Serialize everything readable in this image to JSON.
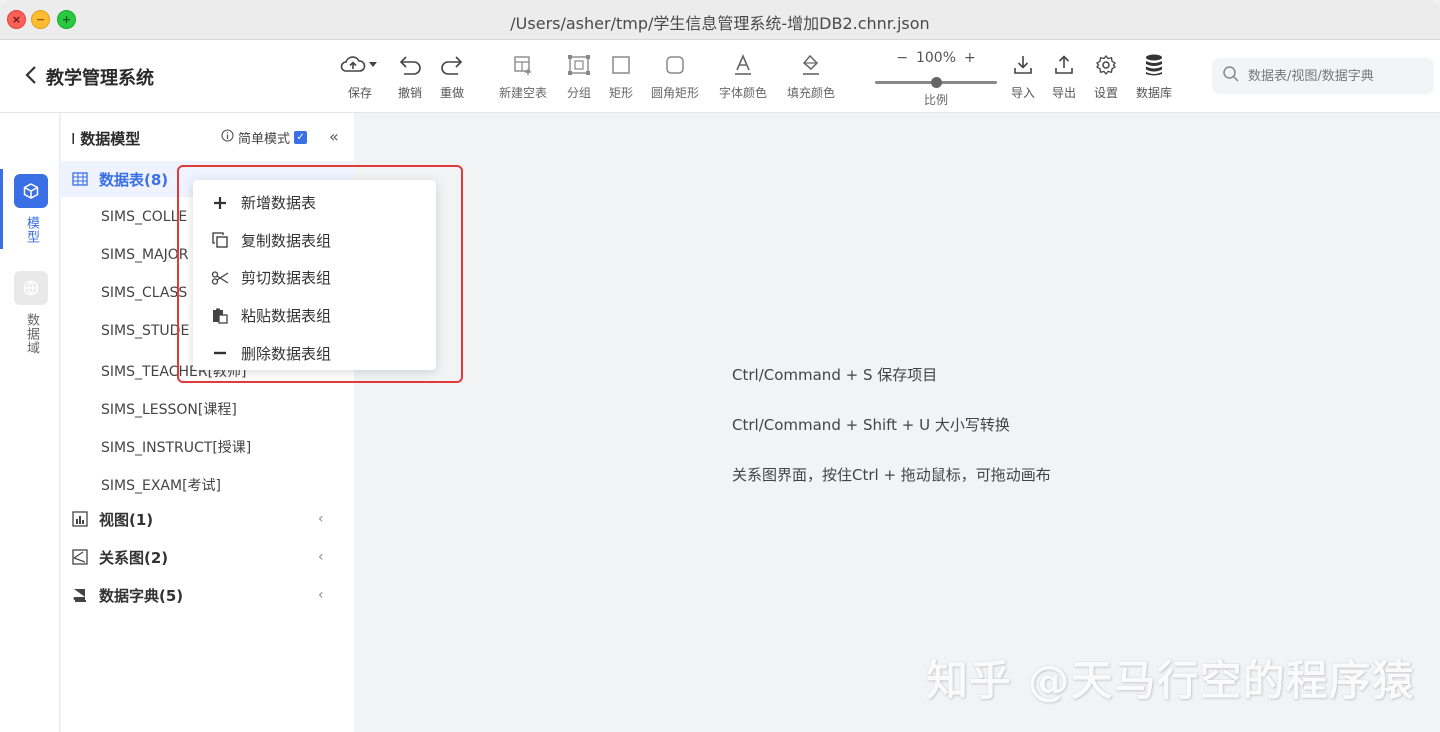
{
  "window": {
    "title": "/Users/asher/tmp/学生信息管理系统-增加DB2.chnr.json",
    "controls": {
      "close": "×",
      "minimize": "−",
      "maximize": "+"
    }
  },
  "header": {
    "app_title": "教学管理系统",
    "back_icon": "chevron-left-icon",
    "tools": [
      {
        "label": "保存",
        "icon": "cloud-upload-icon"
      },
      {
        "label": "撤销",
        "icon": "undo-icon"
      },
      {
        "label": "重做",
        "icon": "redo-icon"
      },
      {
        "label": "新建空表",
        "icon": "new-table-icon"
      },
      {
        "label": "分组",
        "icon": "group-icon"
      },
      {
        "label": "矩形",
        "icon": "rectangle-icon"
      },
      {
        "label": "圆角矩形",
        "icon": "rounded-rectangle-icon"
      },
      {
        "label": "字体颜色",
        "icon": "font-color-icon"
      },
      {
        "label": "填充颜色",
        "icon": "fill-color-icon"
      }
    ],
    "zoom": {
      "minus": "−",
      "value": "100%",
      "plus": "+",
      "label": "比例",
      "level": 0.5
    },
    "right_tools": [
      {
        "label": "导入",
        "icon": "import-icon"
      },
      {
        "label": "导出",
        "icon": "export-icon"
      },
      {
        "label": "设置",
        "icon": "gear-icon"
      },
      {
        "label": "数据库",
        "icon": "database-icon"
      }
    ],
    "search": {
      "placeholder": "数据表/视图/数据字典",
      "value": ""
    }
  },
  "rail": {
    "items": [
      {
        "label": "模型",
        "icon": "cube-icon",
        "active": true
      },
      {
        "label": "数据域",
        "icon": "globe-icon",
        "active": false
      }
    ]
  },
  "panel": {
    "title": "数据模型",
    "simple_mode": {
      "label": "简单模式",
      "checked": true
    },
    "collapse": "«",
    "groups": [
      {
        "label": "数据表(8)",
        "icon": "table-icon",
        "expanded": true
      },
      {
        "label": "视图(1)",
        "icon": "chart-icon",
        "expanded": false
      },
      {
        "label": "关系图(2)",
        "icon": "relation-icon",
        "expanded": false
      },
      {
        "label": "数据字典(5)",
        "icon": "book-icon",
        "expanded": false
      }
    ],
    "tables": [
      "SIMS_COLLE",
      "SIMS_MAJOR",
      "SIMS_CLASS",
      "SIMS_STUDE",
      "SIMS_TEACHER[教师]",
      "SIMS_LESSON[课程]",
      "SIMS_INSTRUCT[授课]",
      "SIMS_EXAM[考试]"
    ]
  },
  "context_menu": {
    "items": [
      {
        "label": "新增数据表",
        "icon": "plus-icon"
      },
      {
        "label": "复制数据表组",
        "icon": "copy-icon"
      },
      {
        "label": "剪切数据表组",
        "icon": "scissors-icon"
      },
      {
        "label": "粘贴数据表组",
        "icon": "paste-icon"
      },
      {
        "label": "删除数据表组",
        "icon": "minus-icon"
      }
    ],
    "highlight_color": "#e03a3a"
  },
  "canvas": {
    "hints": [
      "Ctrl/Command + S 保存项目",
      "Ctrl/Command + Shift + U 大小写转换",
      "关系图界面，按住Ctrl + 拖动鼠标，可拖动画布"
    ],
    "watermark": "知乎 @天马行空的程序猿"
  },
  "colors": {
    "accent": "#3b6fe6",
    "canvas_bg": "#f2f3f5"
  }
}
